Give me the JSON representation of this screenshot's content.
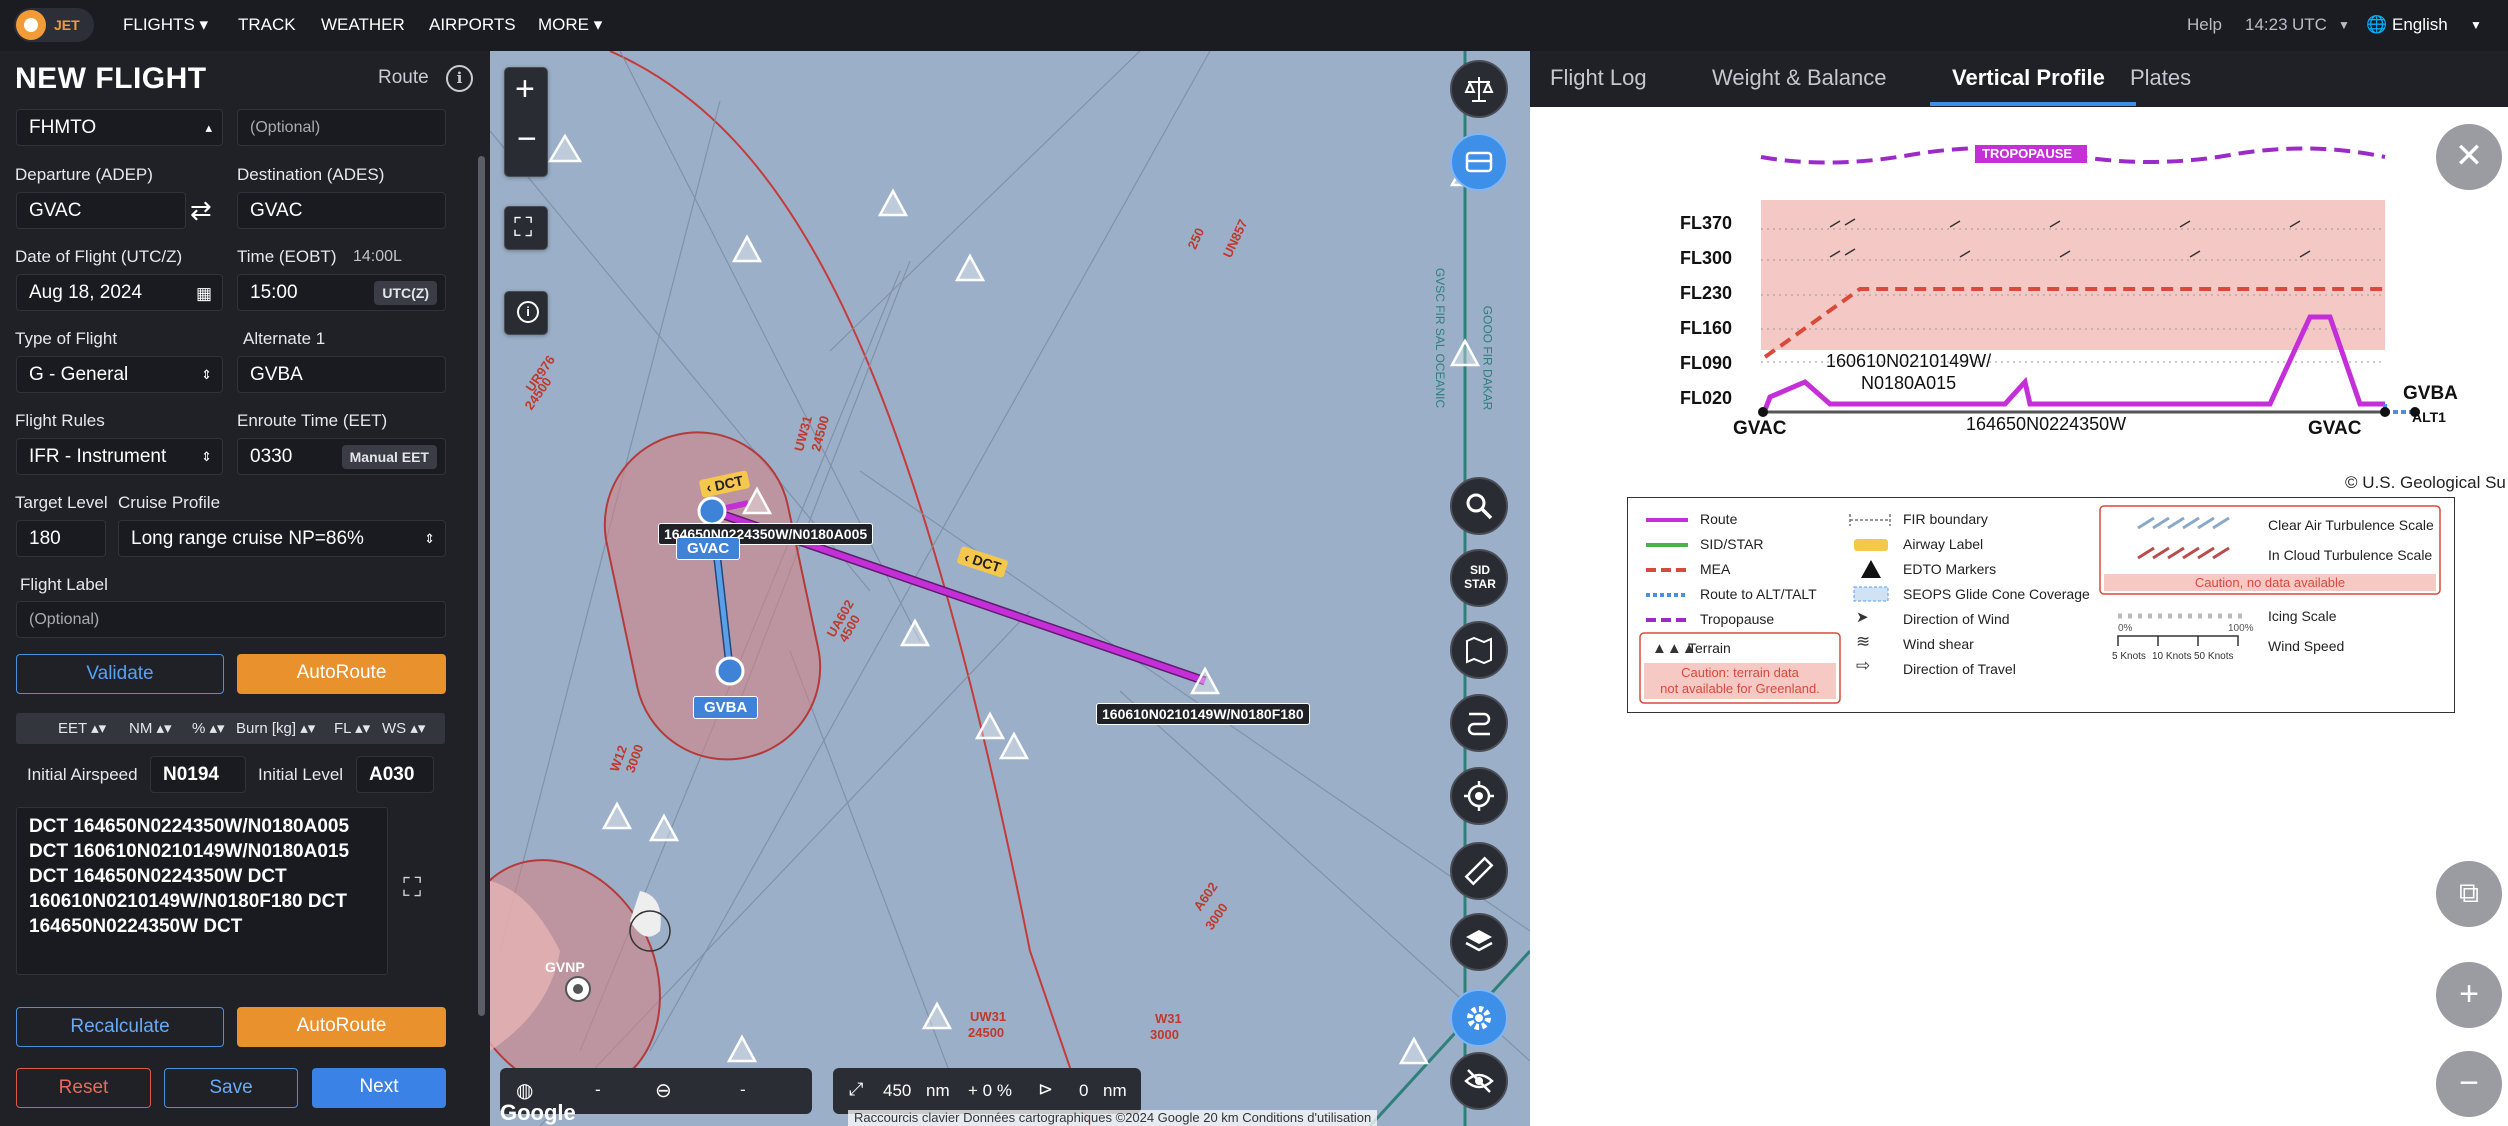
{
  "topbar": {
    "brand": "JET",
    "nav": [
      "FLIGHTS ▾",
      "TRACK",
      "WEATHER",
      "AIRPORTS",
      "MORE ▾"
    ],
    "help": "Help",
    "time": "14:23",
    "utc": "UTC",
    "language": "English"
  },
  "left": {
    "title": "NEW FLIGHT",
    "route_label": "Route",
    "fields": {
      "operator": "FHMTO",
      "operator_optional": "(Optional)",
      "departure_label": "Departure (ADEP)",
      "departure": "GVAC",
      "destination_label": "Destination (ADES)",
      "destination": "GVAC",
      "date_label": "Date of Flight (UTC/Z)",
      "date": "Aug 18, 2024",
      "time_label": "Time (EOBT)",
      "time_local": "14:00L",
      "time": "15:00",
      "time_suffix": "UTC(Z)",
      "type_label": "Type of Flight",
      "type": "G - General",
      "alternate_label": "Alternate 1",
      "alternate": "GVBA",
      "rules_label": "Flight Rules",
      "rules": "IFR - Instrument",
      "eet_label": "Enroute Time (EET)",
      "eet": "0330",
      "eet_suffix": "Manual EET",
      "target_level_label": "Target Level",
      "target_level": "180",
      "cruise_label": "Cruise Profile",
      "cruise": "Long range cruise NP=86%",
      "flight_label_label": "Flight Label",
      "flight_label_ph": "(Optional)"
    },
    "validate": "Validate",
    "autoroute": "AutoRoute",
    "columns": [
      "EET ▴▾",
      "NM ▴▾",
      "% ▴▾",
      "Burn [kg] ▴▾",
      "FL ▴▾",
      "WS ▴▾"
    ],
    "initial_airspeed_label": "Initial Airspeed",
    "initial_airspeed": "N0194",
    "initial_level_label": "Initial Level",
    "initial_level": "A030",
    "route_text": "DCT 164650N0224350W/N0180A005\nDCT 160610N0210149W/N0180A015\nDCT 164650N0224350W DCT\n160610N0210149W/N0180F180 DCT\n164650N0224350W DCT",
    "recalculate": "Recalculate",
    "autoroute2": "AutoRoute",
    "reset": "Reset",
    "save": "Save",
    "next": "Next"
  },
  "map": {
    "wp1_label": "164650N0224350W/N0180A005",
    "wp2_label": "160610N0210149W/N0180F180",
    "gvac": "GVAC",
    "gvba": "GVBA",
    "gvnp": "GVNP",
    "dct": "DCT",
    "sid_star": "SID\nSTAR",
    "bottom_left": [
      "-",
      "-"
    ],
    "distance": "450",
    "distance_unit": "nm",
    "pct": "+ 0 %",
    "offset": "0",
    "offset_unit": "nm",
    "attribution": "Raccourcis clavier   Données cartographiques ©2024 Google   20 km   Conditions d'utilisation",
    "google": "Google",
    "fir_label_1": "GVSC FIR SAL OCEANIC",
    "fir_label_2": "GOOO FIR DAKAR",
    "airways": [
      "UR976",
      "UW31",
      "UA602",
      "W12",
      "UN857",
      "W31",
      "UW31",
      "A602",
      "UW3"
    ],
    "airway_levels": [
      "24500",
      "24500",
      "4500",
      "3000",
      "250",
      "3000",
      "24500",
      "3000",
      "3000"
    ]
  },
  "right": {
    "tabs": [
      "Flight Log",
      "Weight & Balance",
      "Vertical Profile",
      "Plates"
    ],
    "active_tab": "Vertical Profile",
    "profile": {
      "fl_labels": [
        "FL370",
        "FL300",
        "FL230",
        "FL160",
        "FL090",
        "FL020"
      ],
      "start": "GVAC",
      "end": "GVAC",
      "alt": "GVBA",
      "alt_sub": "ALT1",
      "tropopause": "TROPOPAUSE",
      "wp_a": "160610N0210149W/\nN0180A015",
      "wp_b": "164650N0224350W"
    },
    "usgs": "© U.S. Geological Su",
    "legend": {
      "col1": [
        "Route",
        "SID/STAR",
        "MEA",
        "Route to ALT/TALT",
        "Tropopause",
        "Terrain"
      ],
      "col1_caution": "Caution: terrain data\nnot available for Greenland.",
      "col2": [
        "FIR boundary",
        "Airway Label",
        "EDTO Markers",
        "SEOPS Glide Cone Coverage",
        "Direction of Wind",
        "Wind shear",
        "Direction of Travel"
      ],
      "col3": [
        "Clear Air Turbulence Scale",
        "In Cloud Turbulence Scale",
        "Icing Scale",
        "Wind Speed"
      ],
      "col3_caution": "Caution, no data available",
      "icing_ticks": [
        "0%",
        "100%"
      ],
      "wind_ticks": [
        "5 Knots",
        "10 Knots",
        "50 Knots"
      ]
    },
    "colors": {
      "route": "#c42fd8",
      "sid": "#4caf50",
      "mea": "#d94a3a",
      "alt": "#4a90e2",
      "tropo": "#9b2bc8",
      "terrain": "#f3c3bf"
    }
  }
}
